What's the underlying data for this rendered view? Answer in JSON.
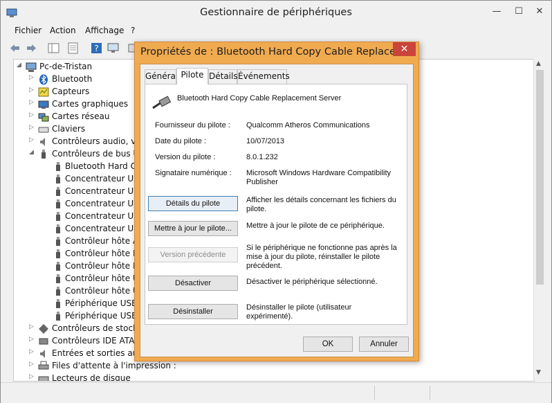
{
  "window": {
    "title": "Gestionnaire de périphériques",
    "minimize": "—",
    "maximize": "☐",
    "close": "✕"
  },
  "menu": [
    "Fichier",
    "Action",
    "Affichage",
    "?"
  ],
  "tree": {
    "root": "Pc-de-Tristan",
    "items": [
      "Bluetooth",
      "Capteurs",
      "Cartes graphiques",
      "Cartes réseau",
      "Claviers",
      "Contrôleurs audio, vid",
      "Contrôleurs de bus US",
      "Bluetooth Hard Co",
      "Concentrateur USB",
      "Concentrateur USB",
      "Concentrateur USB",
      "Concentrateur USB",
      "Concentrateur USB",
      "Contrôleur hôte AM",
      "Contrôleur hôte PC",
      "Contrôleur hôte PC",
      "Contrôleur hôte US",
      "Contrôleur hôte US",
      "Périphérique USB c",
      "Périphérique USB c",
      "Contrôleurs de stockag",
      "Contrôleurs IDE ATA/A",
      "Entrées et sorties audic",
      "Files d'attente à l'impression :",
      "Lecteurs de disque"
    ]
  },
  "dialog": {
    "title": "Propriétés de : Bluetooth Hard Copy Cable Replacem...",
    "close": "✕",
    "tabs": [
      "Général",
      "Pilote",
      "Détails",
      "Événements"
    ],
    "device_name": "Bluetooth Hard Copy Cable Replacement Server",
    "fields": [
      {
        "label": "Fournisseur du pilote :",
        "value": "Qualcomm Atheros Communications"
      },
      {
        "label": "Date du pilote :",
        "value": "10/07/2013"
      },
      {
        "label": "Version du pilote :",
        "value": "8.0.1.232"
      },
      {
        "label": "Signataire numérique :",
        "value": "Microsoft Windows Hardware Compatibility Publisher"
      }
    ],
    "actions": [
      {
        "button": "Détails du pilote",
        "desc": "Afficher les détails concernant les fichiers du pilote."
      },
      {
        "button": "Mettre à jour le pilote...",
        "desc": "Mettre à jour le pilote de ce périphérique."
      },
      {
        "button": "Version précédente",
        "desc": "Si le périphérique ne fonctionne pas après la mise à jour du pilote, réinstaller le pilote précédent."
      },
      {
        "button": "Désactiver",
        "desc": "Désactiver le périphérique sélectionné."
      },
      {
        "button": "Désinstaller",
        "desc": "Désinstaller le pilote (utilisateur expérimenté)."
      }
    ],
    "ok": "OK",
    "cancel": "Annuler"
  }
}
